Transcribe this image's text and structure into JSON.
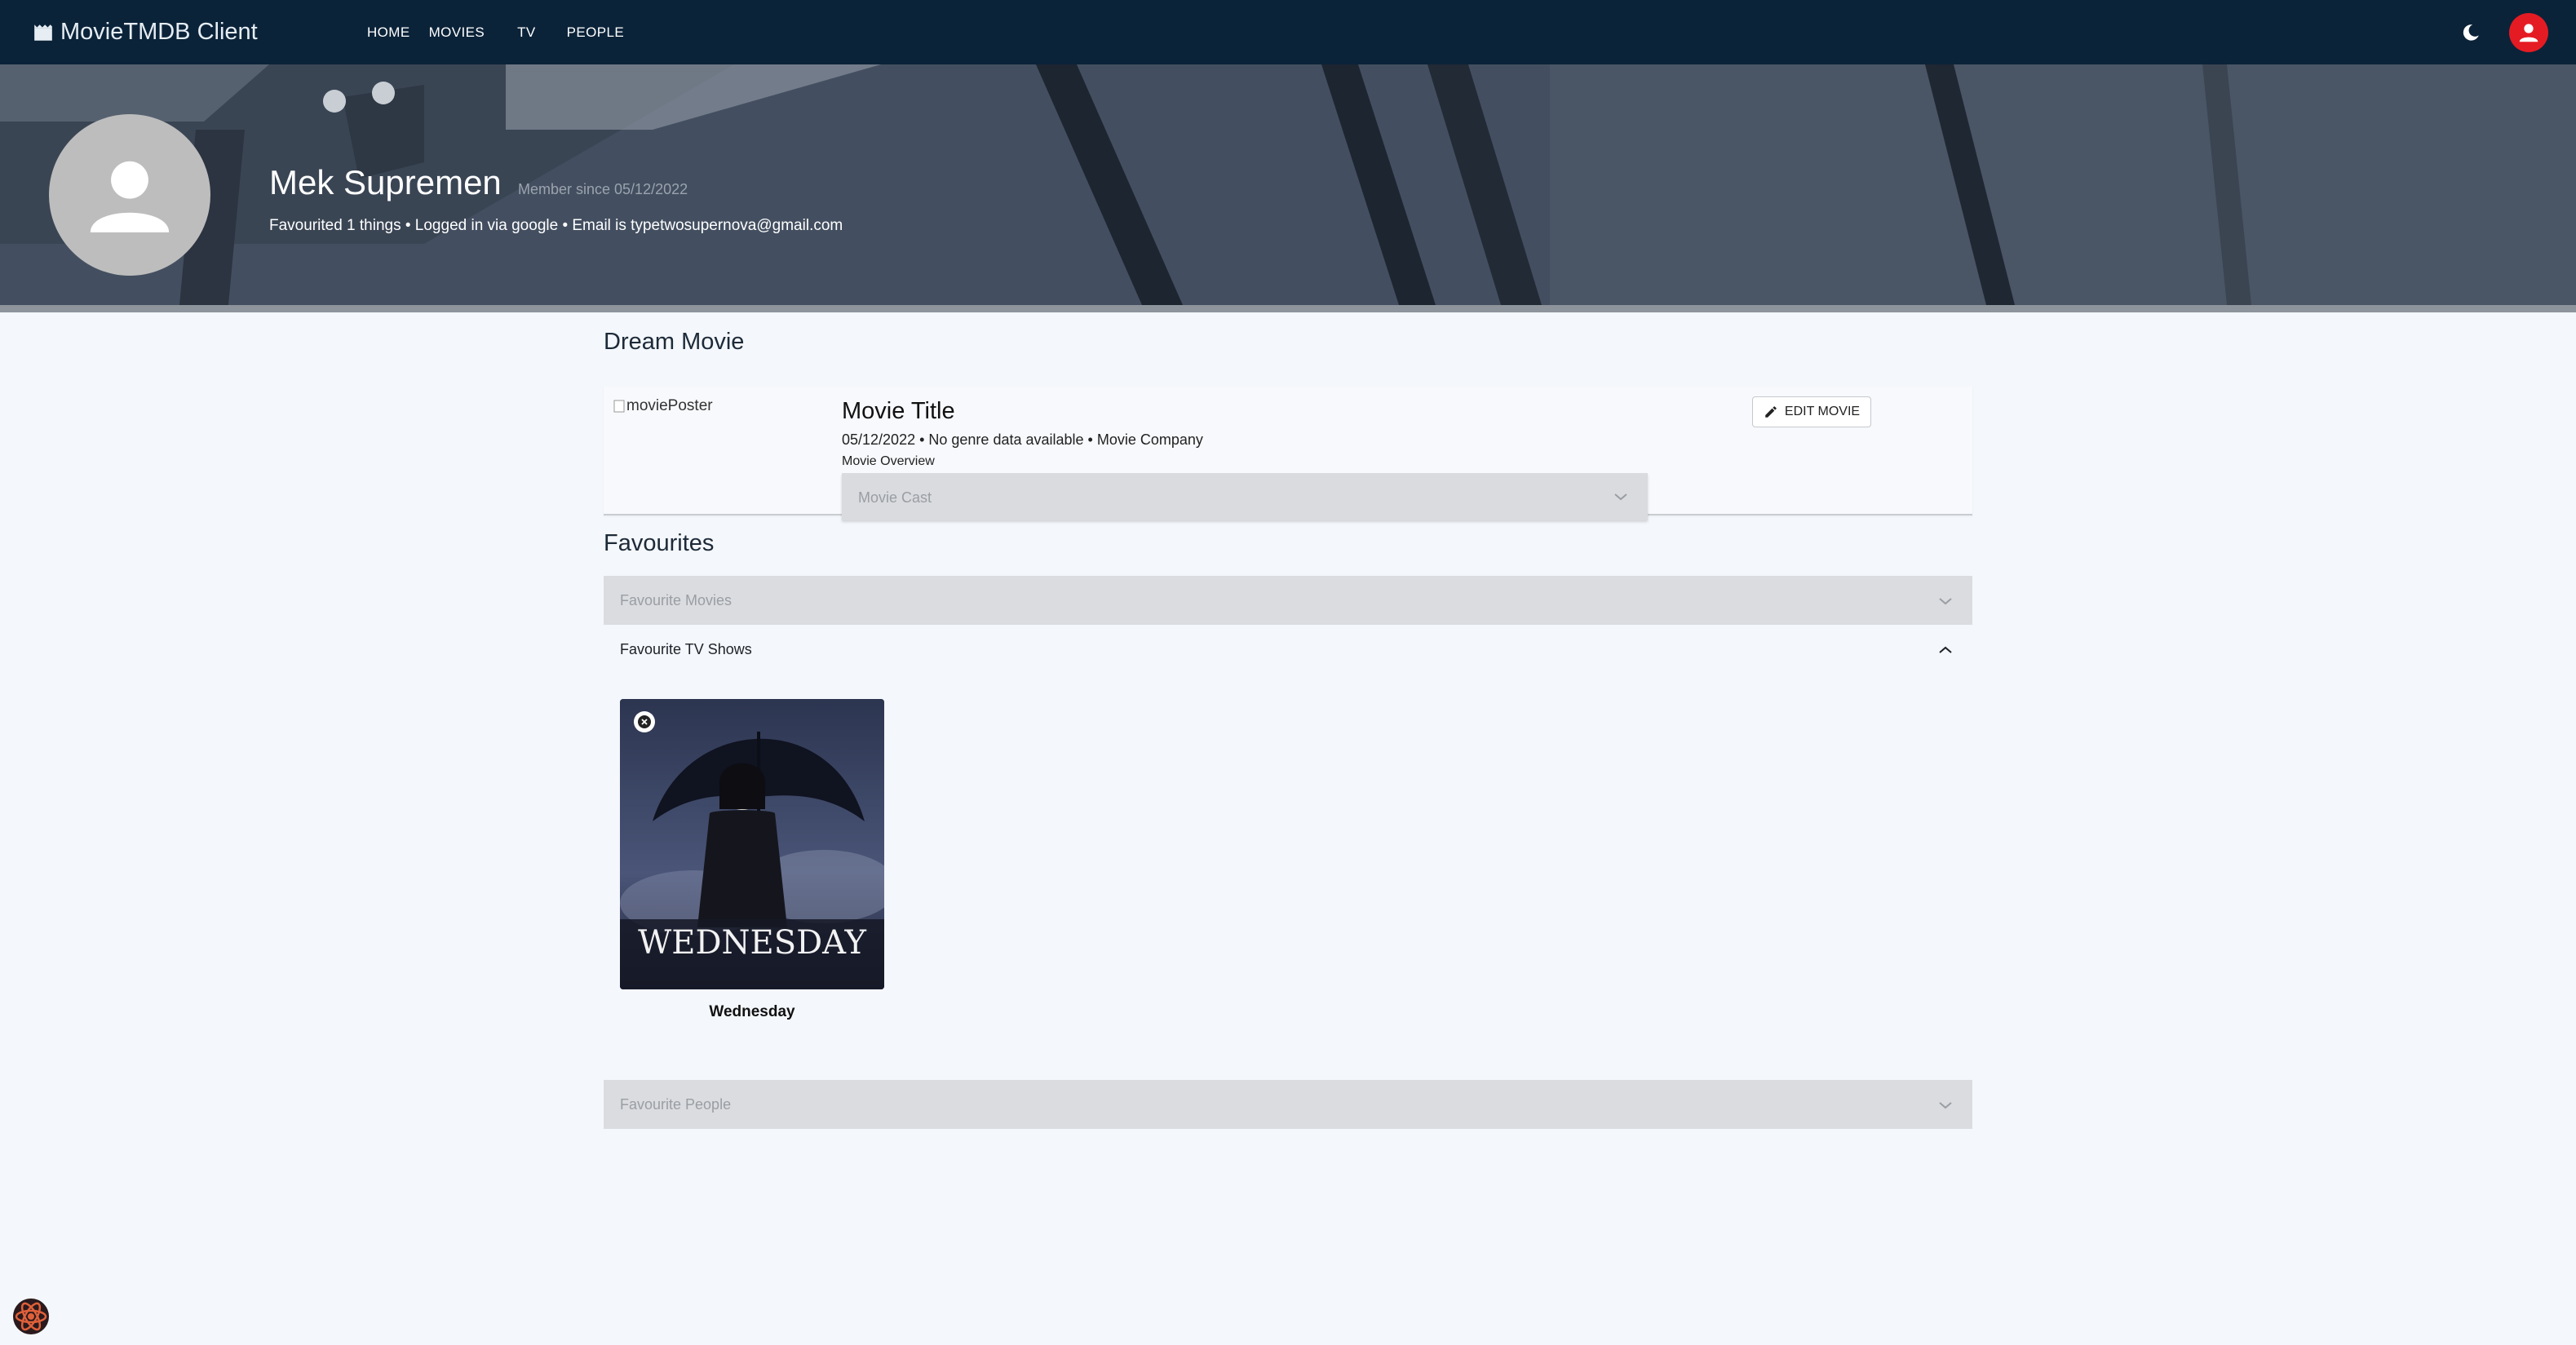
{
  "app": {
    "title": "MovieTMDB Client"
  },
  "nav": {
    "links": [
      "HOME",
      "MOVIES",
      "TV",
      "PEOPLE"
    ],
    "icons": {
      "brand": "clapperboard-icon",
      "theme": "moon-icon",
      "account": "account-icon"
    },
    "colors": {
      "bar": "#0b2339",
      "account": "#e51b23"
    }
  },
  "profile": {
    "name": "Mek Supremen",
    "member_since": "Member since 05/12/2022",
    "info": "Favourited 1 things • Logged in via google • Email is typetwosupernova@gmail.com"
  },
  "dream_movie": {
    "heading": "Dream Movie",
    "poster_alt": "moviePoster",
    "title": "Movie Title",
    "meta": "05/12/2022 • No genre data available • Movie Company",
    "overview": "Movie Overview",
    "edit_label": "EDIT MOVIE",
    "cast_label": "Movie Cast"
  },
  "favourites": {
    "heading": "Favourites",
    "movies_label": "Favourite Movies",
    "tv_label": "Favourite TV Shows",
    "people_label": "Favourite People",
    "tv_shows": [
      {
        "name": "Wednesday",
        "poster_text": "WEDNESDAY"
      }
    ]
  }
}
